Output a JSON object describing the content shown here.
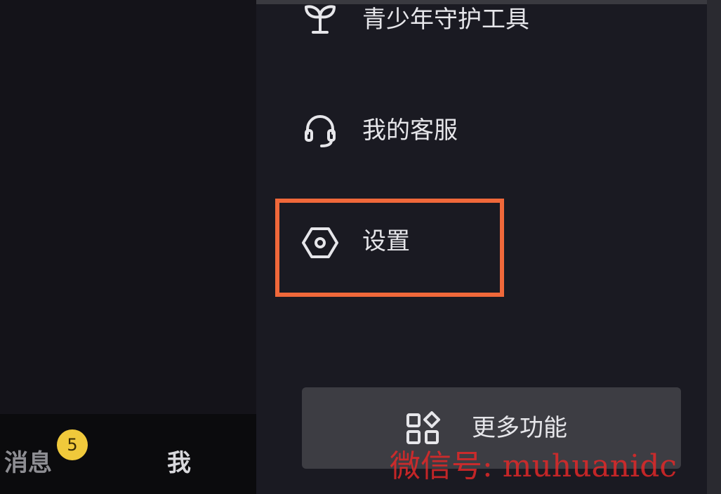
{
  "drawer": {
    "items": [
      {
        "label": "青少年守护工具",
        "icon": "sprout-icon"
      },
      {
        "label": "我的客服",
        "icon": "headset-icon"
      },
      {
        "label": "设置",
        "icon": "hexagon-settings-icon"
      }
    ],
    "more_button": {
      "label": "更多功能",
      "icon": "apps-grid-icon"
    }
  },
  "bottom_nav": {
    "messages_label": "消息",
    "messages_badge": "5",
    "me_label": "我"
  },
  "watermark": "微信号: muhuanidc",
  "colors": {
    "highlight": "#f0683a",
    "badge": "#f0c93b",
    "watermark": "#e22828"
  }
}
